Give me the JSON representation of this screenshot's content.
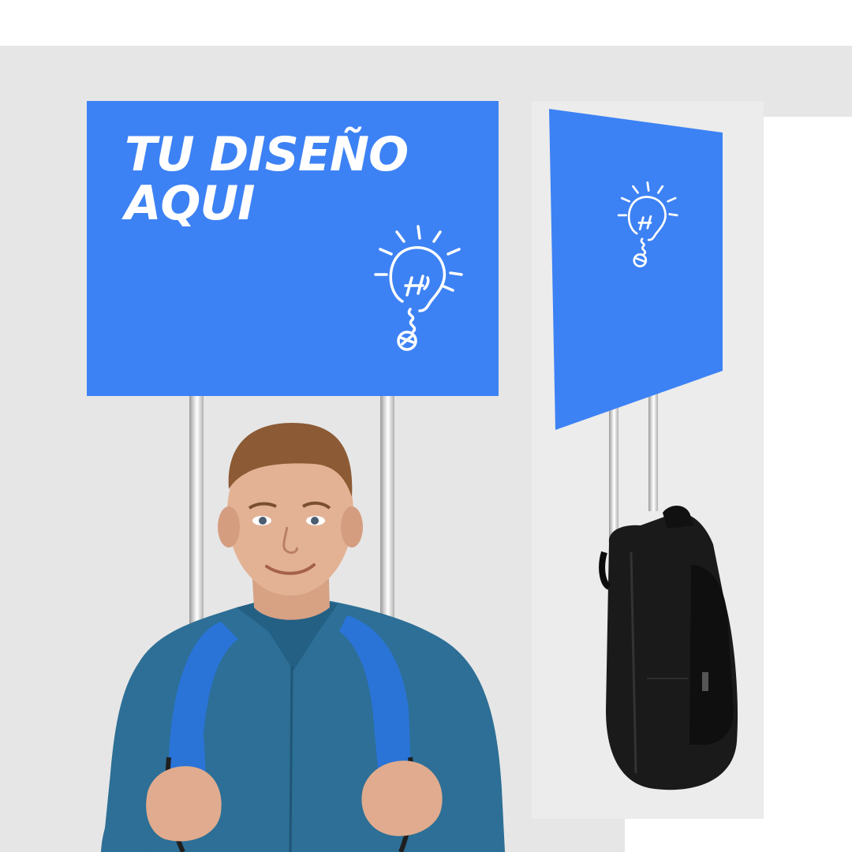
{
  "sign": {
    "headline_line1": "TU DISEÑO",
    "headline_line2": "AQUI"
  },
  "colors": {
    "sign_blue": "#3d82f4",
    "background": "#e6e6e6",
    "text": "#ffffff"
  },
  "icons": [
    "lightbulb-icon"
  ]
}
